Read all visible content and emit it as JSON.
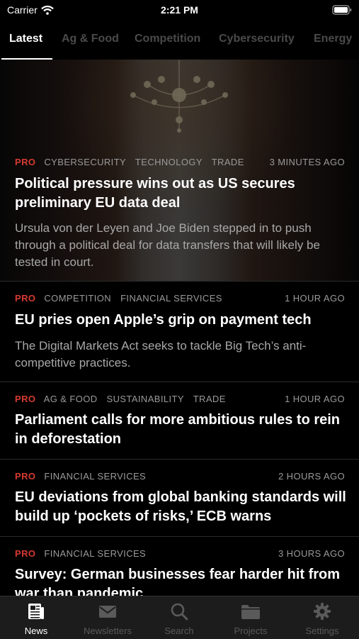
{
  "status_bar": {
    "carrier": "Carrier",
    "time": "2:21 PM"
  },
  "tabs": [
    "Latest",
    "Ag & Food",
    "Competition",
    "Cybersecurity",
    "Energy"
  ],
  "articles": [
    {
      "pro": "PRO",
      "tags": [
        "CYBERSECURITY",
        "TECHNOLOGY",
        "TRADE"
      ],
      "time": "3 MINUTES AGO",
      "headline": "Political pressure wins out as US secures preliminary EU data deal",
      "summary": "Ursula von der Leyen and Joe Biden stepped in to push through a political deal for data transfers that will likely be tested in court."
    },
    {
      "pro": "PRO",
      "tags": [
        "COMPETITION",
        "FINANCIAL SERVICES"
      ],
      "time": "1 HOUR AGO",
      "headline": "EU pries open Apple’s grip on payment tech",
      "summary": "The Digital Markets Act seeks to tackle Big Tech’s anti-competitive practices."
    },
    {
      "pro": "PRO",
      "tags": [
        "AG & FOOD",
        "SUSTAINABILITY",
        "TRADE"
      ],
      "time": "1 HOUR AGO",
      "headline": "Parliament calls for more ambitious rules to rein in deforestation"
    },
    {
      "pro": "PRO",
      "tags": [
        "FINANCIAL SERVICES"
      ],
      "time": "2 HOURS AGO",
      "headline": "EU deviations from global banking standards will build up ‘pockets of risks,’ ECB warns"
    },
    {
      "pro": "PRO",
      "tags": [
        "FINANCIAL SERVICES"
      ],
      "time": "3 HOURS AGO",
      "headline": "Survey: German businesses fear harder hit from war than pandemic"
    }
  ],
  "tabbar": [
    {
      "label": "News",
      "icon": "news-icon"
    },
    {
      "label": "Newsletters",
      "icon": "envelope-icon"
    },
    {
      "label": "Search",
      "icon": "search-icon"
    },
    {
      "label": "Projects",
      "icon": "folder-icon"
    },
    {
      "label": "Settings",
      "icon": "gear-icon"
    }
  ],
  "colors": {
    "pro": "#d63a2f",
    "background": "#000000",
    "tabbar": "#1c1c1c"
  }
}
